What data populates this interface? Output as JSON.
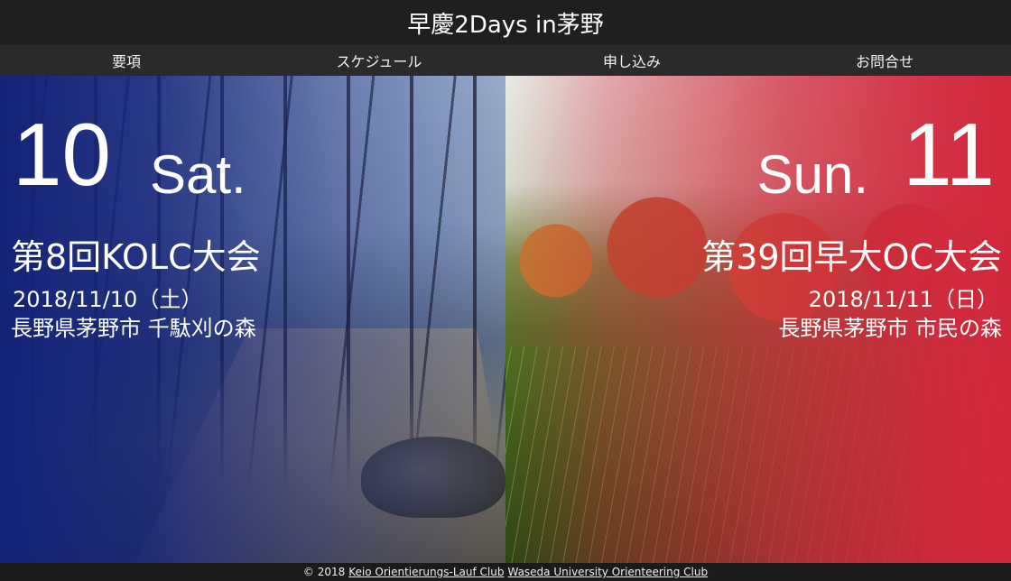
{
  "site": {
    "title": "早慶2Days in茅野"
  },
  "nav": [
    {
      "label": "要項"
    },
    {
      "label": "スケジュール"
    },
    {
      "label": "申し込み"
    },
    {
      "label": "お問合せ"
    }
  ],
  "day1": {
    "day": "10",
    "weekday": "Sat.",
    "title": "第8回KOLC大会",
    "date": "2018/11/10（土）",
    "venue": "長野県茅野市 千駄刈の森",
    "overlay_color": "#14237a"
  },
  "day2": {
    "day": "11",
    "weekday": "Sun.",
    "title": "第39回早大OC大会",
    "date": "2018/11/11（日）",
    "venue": "長野県茅野市 市民の森",
    "overlay_color": "#d2283c"
  },
  "footer": {
    "copyright": "© 2018",
    "link1": "Keio Orientierungs-Lauf Club",
    "link2": "Waseda University Orienteering Club"
  }
}
